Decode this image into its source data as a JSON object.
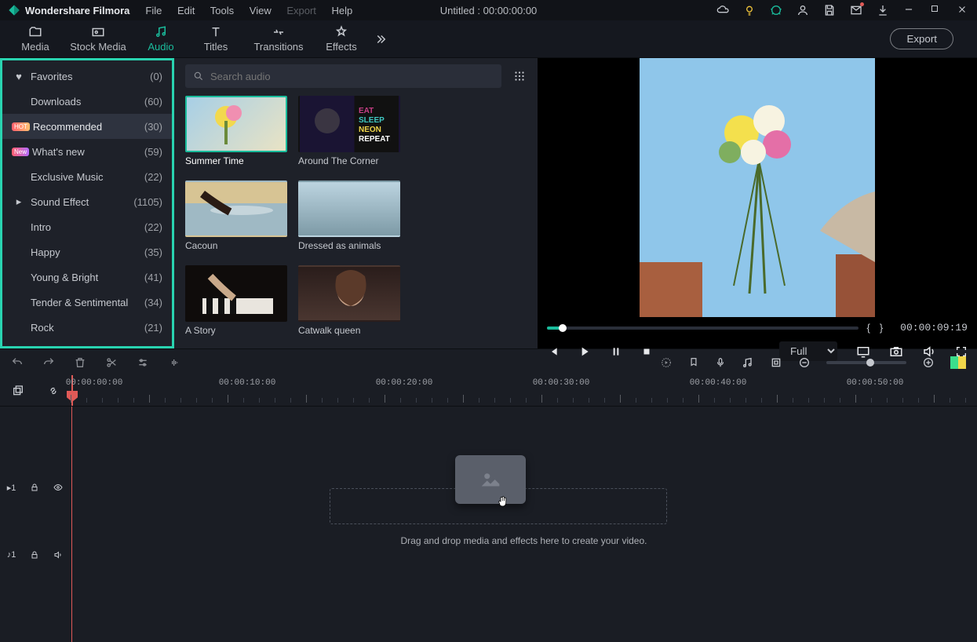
{
  "app": {
    "name": "Wondershare Filmora",
    "document_title": "Untitled : 00:00:00:00"
  },
  "menus": {
    "file": "File",
    "edit": "Edit",
    "tools": "Tools",
    "view": "View",
    "export": "Export",
    "help": "Help"
  },
  "tabs": {
    "media": "Media",
    "stock_media": "Stock Media",
    "audio": "Audio",
    "titles": "Titles",
    "transitions": "Transitions",
    "effects": "Effects",
    "export_btn": "Export"
  },
  "search": {
    "placeholder": "Search audio"
  },
  "sidebar": {
    "items": [
      {
        "label": "Favorites",
        "count": "(0)",
        "icon": "heart"
      },
      {
        "label": "Downloads",
        "count": "(60)"
      },
      {
        "label": "Recommended",
        "count": "(30)",
        "badge": "HOT"
      },
      {
        "label": "What's new",
        "count": "(59)",
        "badge": "New"
      },
      {
        "label": "Exclusive Music",
        "count": "(22)"
      },
      {
        "label": "Sound Effect",
        "count": "(1105)",
        "icon": "chevron"
      },
      {
        "label": "Intro",
        "count": "(22)"
      },
      {
        "label": "Happy",
        "count": "(35)"
      },
      {
        "label": "Young & Bright",
        "count": "(41)"
      },
      {
        "label": "Tender & Sentimental",
        "count": "(34)"
      },
      {
        "label": "Rock",
        "count": "(21)"
      }
    ]
  },
  "cards": [
    {
      "title": "Summer Time"
    },
    {
      "title": "Around The Corner"
    },
    {
      "title": "Cacoun"
    },
    {
      "title": "Dressed as animals"
    },
    {
      "title": "A Story"
    },
    {
      "title": "Catwalk queen"
    }
  ],
  "preview": {
    "timecode": "00:00:09:19",
    "resolution": "Full"
  },
  "ruler": {
    "marks": [
      "00:00:00:00",
      "00:00:10:00",
      "00:00:20:00",
      "00:00:30:00",
      "00:00:40:00",
      "00:00:50:00"
    ]
  },
  "tracks": {
    "video": "1",
    "audio": "1"
  },
  "timeline": {
    "drop_hint": "Drag and drop media and effects here to create your video."
  }
}
